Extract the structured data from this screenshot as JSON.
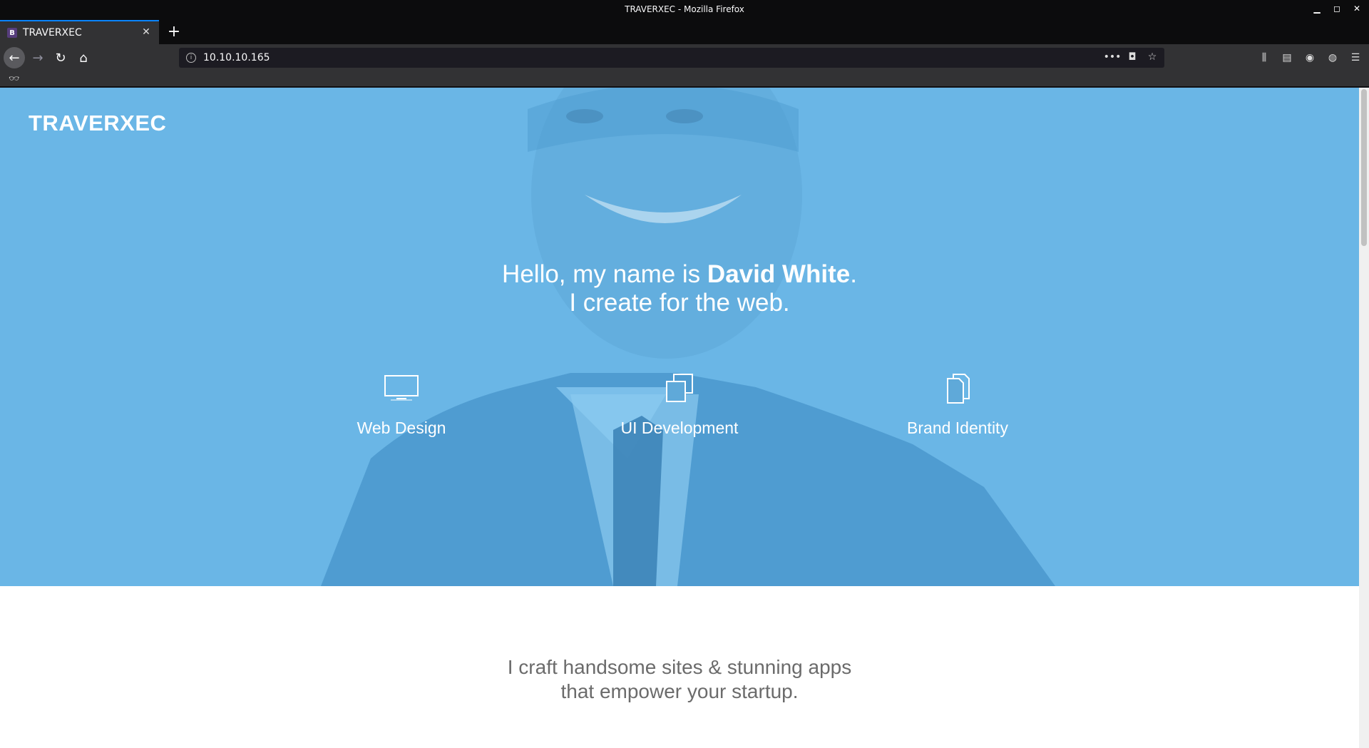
{
  "window": {
    "title": "TRAVERXEC - Mozilla Firefox"
  },
  "tab": {
    "favicon": "B",
    "label": "TRAVERXEC"
  },
  "address_bar": {
    "url": "10.10.10.165"
  },
  "page": {
    "logo": "TRAVERXEC",
    "headline_prefix": "Hello, my name is ",
    "headline_name": "David White",
    "headline_suffix": ".",
    "headline_line2": "I create for the web.",
    "services": [
      {
        "label": "Web Design",
        "icon": "monitor-icon"
      },
      {
        "label": "UI Development",
        "icon": "stacked-windows-icon"
      },
      {
        "label": "Brand Identity",
        "icon": "documents-icon"
      }
    ],
    "tagline_line1": "I craft handsome sites & stunning apps",
    "tagline_line2": "that empower your startup."
  },
  "colors": {
    "hero_blue": "#6ab6e6",
    "chrome_dark": "#0c0c0d",
    "toolbar": "#323234"
  }
}
